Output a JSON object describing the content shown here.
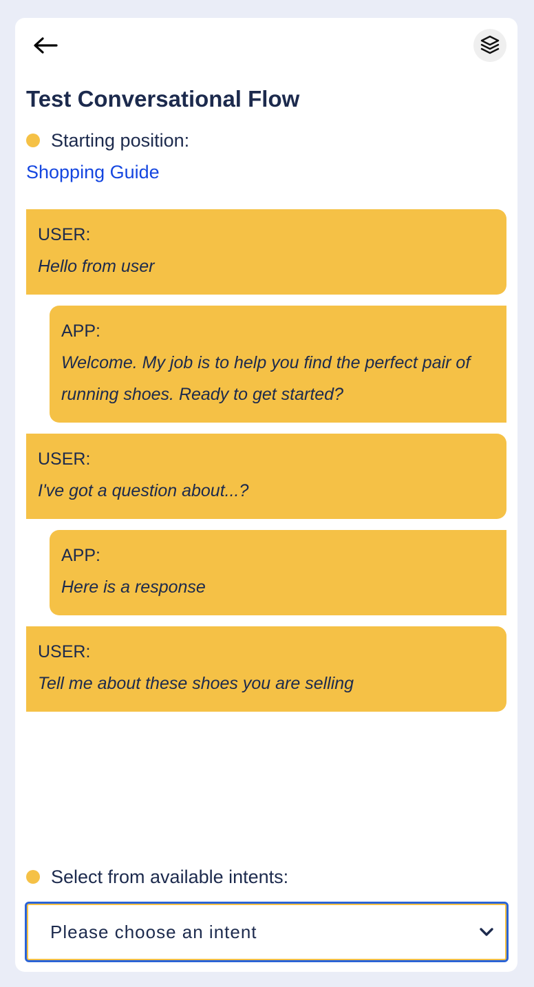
{
  "header": {
    "back_icon": "arrow-left-icon",
    "layers_icon": "layers-icon",
    "title": "Test Conversational Flow"
  },
  "starting": {
    "label": "Starting position:",
    "link": "Shopping Guide",
    "dot_color": "#f5c146"
  },
  "messages": [
    {
      "role": "USER:",
      "text": "Hello from user",
      "type": "user"
    },
    {
      "role": "APP:",
      "text": "Welcome. My job is to help you find the perfect pair of running shoes. Ready to get started?",
      "type": "app"
    },
    {
      "role": "USER:",
      "text": "I've got a question about...?",
      "type": "user"
    },
    {
      "role": "APP:",
      "text": "Here is a response",
      "type": "app"
    },
    {
      "role": "USER:",
      "text": "Tell me about these shoes you are selling",
      "type": "user"
    }
  ],
  "intents": {
    "label": "Select from available intents:",
    "selected": "Please choose an intent",
    "chevron_icon": "chevron-down-icon"
  },
  "colors": {
    "bubble": "#f5c146",
    "text": "#1c2a4d",
    "link": "#1446e0",
    "background": "#eaedf7",
    "select_border": "#2a63d6"
  }
}
